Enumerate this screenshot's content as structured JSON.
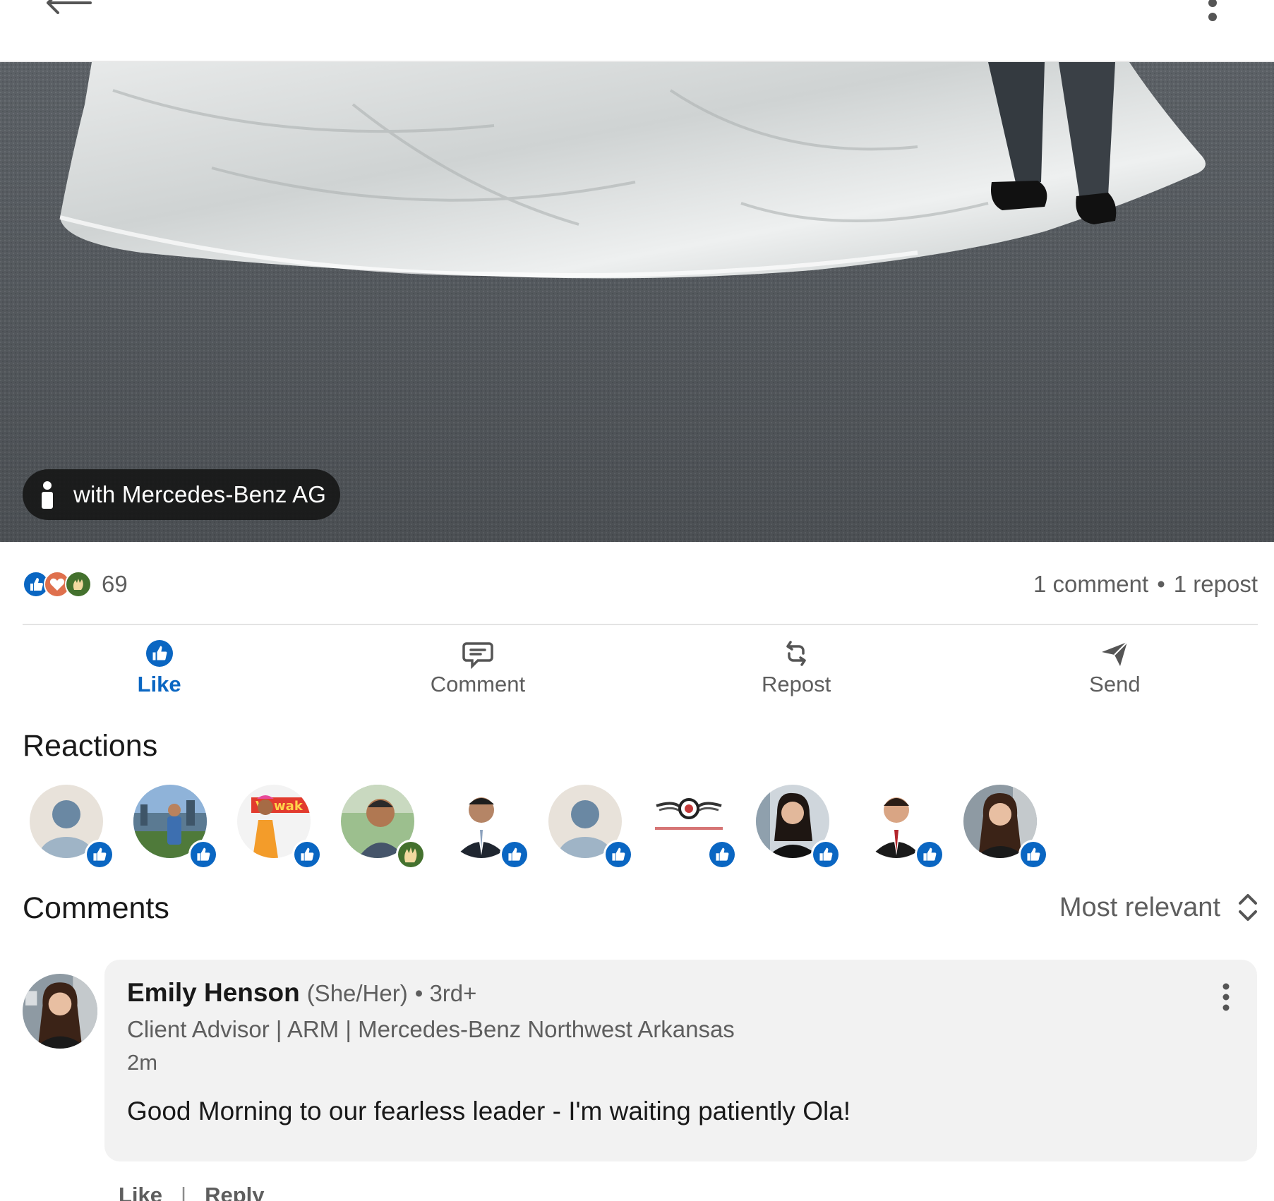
{
  "post": {
    "tag_label": "with Mercedes-Benz AG"
  },
  "social": {
    "reaction_count": "69",
    "comments_label": "1 comment",
    "separator": "•",
    "reposts_label": "1 repost"
  },
  "actions": {
    "like": "Like",
    "comment": "Comment",
    "repost": "Repost",
    "send": "Send"
  },
  "reactions": {
    "title": "Reactions",
    "avatars": [
      {
        "badge": "like-icon"
      },
      {
        "badge": "like-icon"
      },
      {
        "badge": "like-icon"
      },
      {
        "badge": "celebrate-icon"
      },
      {
        "badge": "like-icon"
      },
      {
        "badge": "like-icon"
      },
      {
        "badge": "like-icon"
      },
      {
        "badge": "like-icon"
      },
      {
        "badge": "like-icon"
      },
      {
        "badge": "like-icon"
      }
    ]
  },
  "comments": {
    "title": "Comments",
    "sort_label": "Most relevant",
    "items": [
      {
        "name": "Emily Henson",
        "pronouns": "(She/Her)",
        "degree": "• 3rd+",
        "headline": "Client Advisor | ARM | Mercedes-Benz Northwest Arkansas",
        "time": "2m",
        "text": "Good Morning to our fearless leader - I'm waiting patiently Ola!",
        "like_label": "Like",
        "separator": "|",
        "reply_label": "Reply"
      }
    ]
  },
  "colors": {
    "linkedin_blue": "#0a66c2",
    "celebrate_green": "#44712e",
    "love_red": "#df704d",
    "secondary_text": "#5e5e5e"
  }
}
